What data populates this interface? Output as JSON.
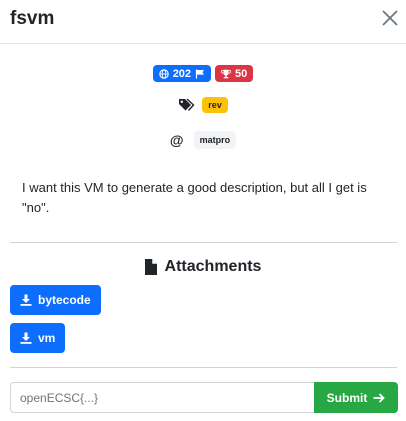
{
  "modal": {
    "title": "fsvm",
    "close_label": "×"
  },
  "stats": {
    "solves": "202",
    "points": "50",
    "solves_color": "#0d6efd",
    "points_color": "#dc3545"
  },
  "tags": {
    "icon": "tags-icon",
    "items": [
      "rev"
    ]
  },
  "author": {
    "symbol": "@",
    "name": "matpro"
  },
  "description": "I want this VM to generate a good description, but all I get is \"no\".",
  "attachments": {
    "title": "Attachments",
    "files": [
      "bytecode",
      "vm"
    ]
  },
  "flag_form": {
    "placeholder": "openECSC{...}",
    "submit_label": "Submit"
  }
}
